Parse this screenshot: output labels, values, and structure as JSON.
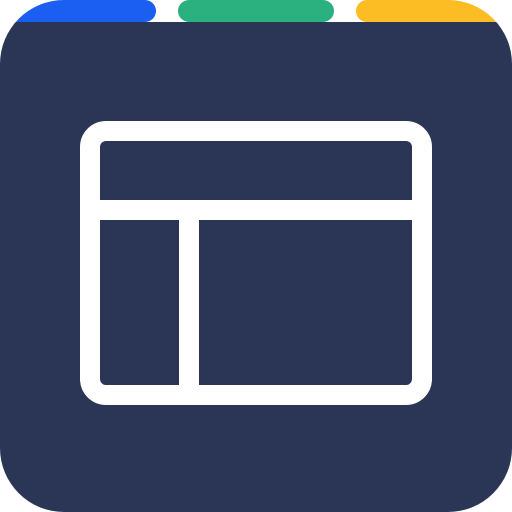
{
  "icon": {
    "name": "layout-template-icon",
    "depicts": "window-layout-with-header-sidebar-and-content-panes"
  },
  "colors": {
    "tile_background": "#2b3656",
    "glyph_stroke": "#ffffff",
    "tab_left": "#1a5ff2",
    "tab_middle": "#2bb07f",
    "tab_right": "#fbbd23"
  }
}
